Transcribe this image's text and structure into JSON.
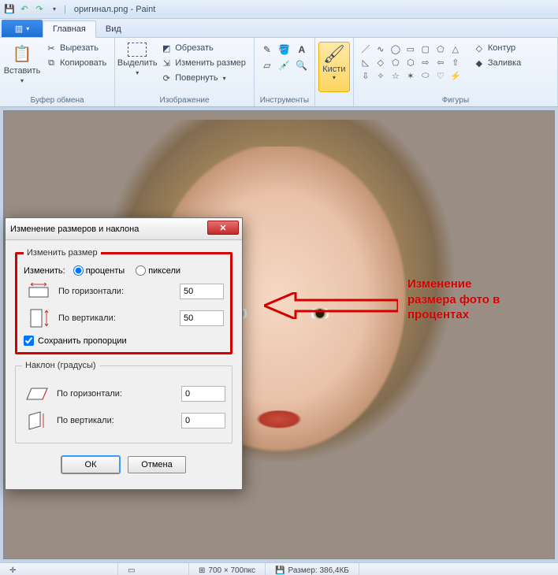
{
  "title": "оригинал.png - Paint",
  "tabs": {
    "home": "Главная",
    "view": "Вид"
  },
  "ribbon": {
    "clipboard": {
      "paste": "Вставить",
      "cut": "Вырезать",
      "copy": "Копировать",
      "label": "Буфер обмена"
    },
    "image": {
      "select": "Выделить",
      "crop": "Обрезать",
      "resize": "Изменить размер",
      "rotate": "Повернуть",
      "label": "Изображение"
    },
    "tools": {
      "label": "Инструменты"
    },
    "brushes": {
      "label": "Кисти"
    },
    "shapes": {
      "outline": "Контур",
      "fill": "Заливка",
      "label": "Фигуры"
    }
  },
  "dialog": {
    "title": "Изменение размеров и наклона",
    "resize": {
      "legend": "Изменить размер",
      "by_label": "Изменить:",
      "percent": "проценты",
      "pixels": "пиксели",
      "horiz": "По горизонтали:",
      "vert": "По вертикали:",
      "h_value": "50",
      "v_value": "50",
      "keep_ratio": "Сохранить пропорции"
    },
    "skew": {
      "legend": "Наклон (градусы)",
      "horiz": "По горизонтали:",
      "vert": "По вертикали:",
      "h_value": "0",
      "v_value": "0"
    },
    "ok": "ОК",
    "cancel": "Отмена"
  },
  "annotation": {
    "line1": "Изменение",
    "line2": "размера фото в",
    "line3": "процентах"
  },
  "status": {
    "coords": "",
    "dims": "700 × 700пкс",
    "size": "Размер: 386,4КБ"
  }
}
